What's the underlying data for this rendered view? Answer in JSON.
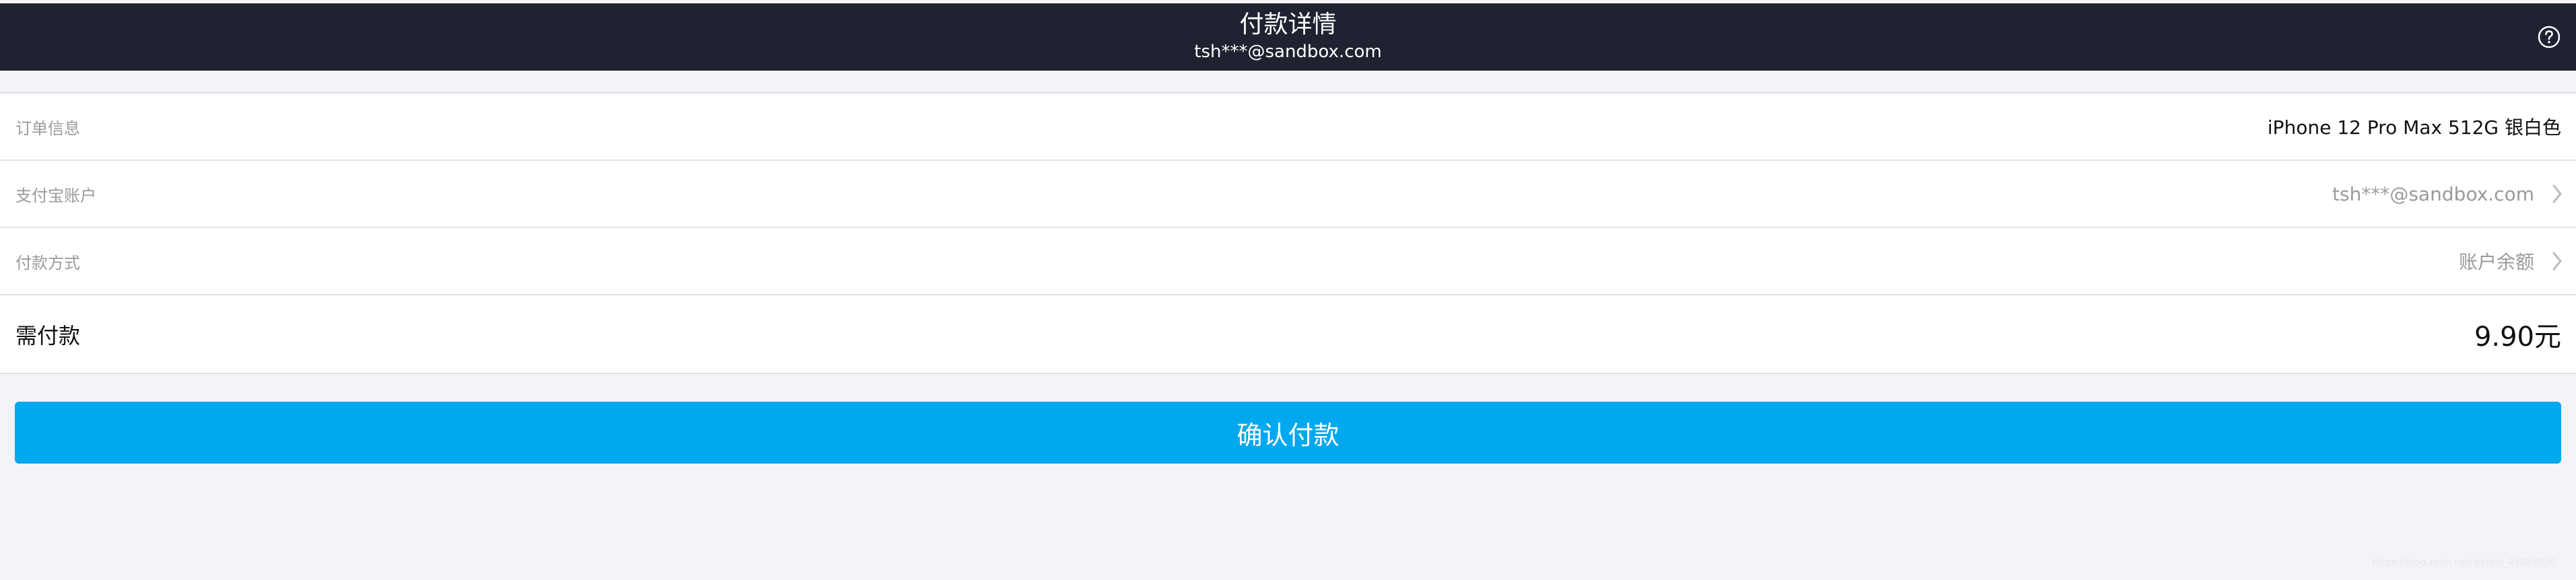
{
  "header": {
    "title": "付款详情",
    "subtitle": "tsh***@sandbox.com",
    "help_icon": "question-circle-icon"
  },
  "rows": [
    {
      "label": "订单信息",
      "value": "iPhone 12 Pro Max 512G 银白色"
    },
    {
      "label": "支付宝账户",
      "value": "tsh***@sandbox.com",
      "icon": "chevron-right-icon"
    },
    {
      "label": "付款方式",
      "value": "账户余额",
      "icon": "chevron-right-icon"
    },
    {
      "label": "需付款",
      "value": "9.90元"
    }
  ],
  "confirm_button": {
    "label": "确认付款"
  },
  "watermark": "https://blog.csdn.net/weixin_45923930",
  "colors": {
    "header_bg": "#1f2230",
    "accent": "#00a8ee",
    "page_bg": "#f3f3f8"
  }
}
